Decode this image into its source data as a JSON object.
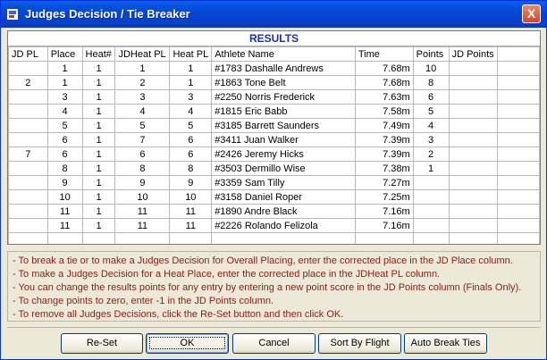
{
  "window": {
    "title": "Judges Decision / Tie Breaker",
    "close_label": "X"
  },
  "grid": {
    "title": "RESULTS",
    "columns": [
      "JD PL",
      "Place",
      "Heat#",
      "JDHeat PL",
      "Heat PL",
      "Athlete Name",
      "Time",
      "Points",
      "JD Points",
      ""
    ],
    "rows": [
      [
        "",
        "1",
        "1",
        "1",
        "1",
        "#1783 Dashalle Andrews",
        "7.68m",
        "10",
        "",
        ""
      ],
      [
        "2",
        "1",
        "1",
        "2",
        "1",
        "#1863 Tone Belt",
        "7.68m",
        "8",
        "",
        ""
      ],
      [
        "",
        "3",
        "1",
        "3",
        "3",
        "#2250 Norris Frederick",
        "7.63m",
        "6",
        "",
        ""
      ],
      [
        "",
        "4",
        "1",
        "4",
        "4",
        "#1815 Eric Babb",
        "7.58m",
        "5",
        "",
        ""
      ],
      [
        "",
        "5",
        "1",
        "5",
        "5",
        "#3185 Barrett Saunders",
        "7.49m",
        "4",
        "",
        ""
      ],
      [
        "",
        "6",
        "1",
        "7",
        "6",
        "#3411 Juan Walker",
        "7.39m",
        "3",
        "",
        ""
      ],
      [
        "7",
        "6",
        "1",
        "6",
        "6",
        "#2426 Jeremy Hicks",
        "7.39m",
        "2",
        "",
        ""
      ],
      [
        "",
        "8",
        "1",
        "8",
        "8",
        "#3503 Dermillo Wise",
        "7.38m",
        "1",
        "",
        ""
      ],
      [
        "",
        "9",
        "1",
        "9",
        "9",
        "#3359 Sam Tilly",
        "7.27m",
        "",
        "",
        ""
      ],
      [
        "",
        "10",
        "1",
        "10",
        "10",
        "#3158 Daniel Roper",
        "7.25m",
        "",
        "",
        ""
      ],
      [
        "",
        "11",
        "1",
        "11",
        "11",
        "#1890 Andre Black",
        "7.16m",
        "",
        "",
        ""
      ],
      [
        "",
        "11",
        "1",
        "11",
        "11",
        "#2226 Rolando Felizola",
        "7.16m",
        "",
        "",
        ""
      ],
      [
        "",
        "",
        "",
        "",
        "",
        "",
        "",
        "",
        "",
        ""
      ]
    ]
  },
  "instructions": [
    "- To break a tie or to make a Judges Decision for Overall Placing, enter the corrected place in the JD Place column.",
    "- To make a Judges Decision for a Heat Place, enter the corrected place in the JDHeat PL column.",
    "- You can change the results points for any entry by entering a new point score in the JD Points column (Finals Only).",
    "- To change points to zero, enter -1 in the JD Points column.",
    "- To remove all Judges Decisions, click the Re-Set button and then click OK."
  ],
  "buttons": {
    "reset": "Re-Set",
    "ok": "OK",
    "cancel": "Cancel",
    "sort_by_flight": "Sort By Flight",
    "auto_break_ties": "Auto Break Ties"
  }
}
